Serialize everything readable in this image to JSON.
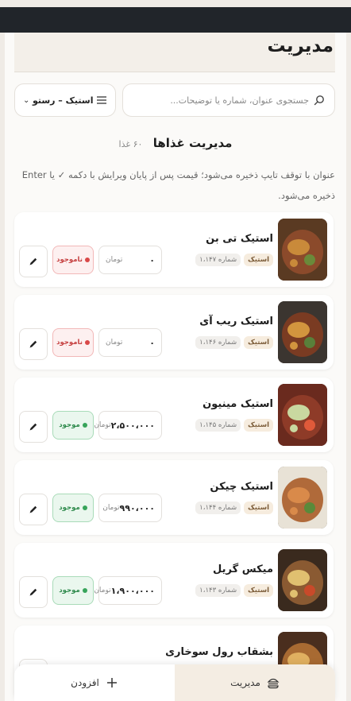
{
  "header": {
    "title": "مدیریت"
  },
  "search": {
    "placeholder": "جستجوی عنوان، شماره یا توضیحات..."
  },
  "filter": {
    "selected": "استیک – رستو"
  },
  "section": {
    "title": "مدیریت غذاها",
    "count": "۶۰ غذا"
  },
  "help_text": "عنوان با توقف تایپ ذخیره می‌شود؛ قیمت پس از پایان ویرایش با دکمه ✓ یا Enter ذخیره می‌شود.",
  "price_unit": "تومان",
  "status_labels": {
    "in": "موجود",
    "out": "ناموجود"
  },
  "foods": [
    {
      "name": "استیک تی بن",
      "category": "استیک",
      "number": "شماره ۱،۱۴۷",
      "price": "۰",
      "status": "out"
    },
    {
      "name": "استیک ریب آی",
      "category": "استیک",
      "number": "شماره ۱،۱۴۶",
      "price": "۰",
      "status": "out"
    },
    {
      "name": "استیک مینیون",
      "category": "استیک",
      "number": "شماره ۱،۱۴۵",
      "price": "۲،۵۰۰،۰۰۰",
      "status": "in"
    },
    {
      "name": "استیک چیکن",
      "category": "استیک",
      "number": "شماره ۱،۱۴۴",
      "price": "۹۹۰،۰۰۰",
      "status": "in"
    },
    {
      "name": "میکس گریل",
      "category": "استیک",
      "number": "شماره ۱،۱۴۳",
      "price": "۱،۹۰۰،۰۰۰",
      "status": "in"
    },
    {
      "name": "بشقاب رول سوخاری",
      "category": "",
      "number": "",
      "price": "",
      "status": ""
    }
  ],
  "nav": {
    "manage_label": "مدیریت",
    "add_label": "افزودن"
  },
  "colors": {
    "accent_bg": "#f4ede3",
    "in_stock": "#37a45a",
    "out_of_stock": "#d94848"
  }
}
